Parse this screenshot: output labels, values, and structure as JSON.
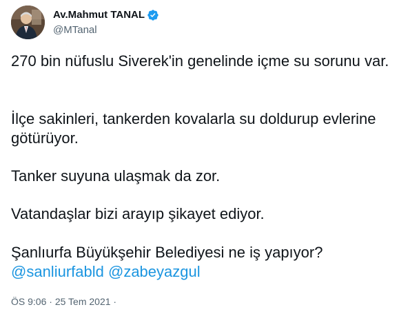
{
  "author": {
    "display_name": "Av.Mahmut TANAL",
    "handle": "@MTanal",
    "verified_icon": "verified-badge-icon",
    "avatar_icon": "profile-photo"
  },
  "tweet": {
    "paragraph_1": "270 bin nüfuslu Siverek'in genelinde içme su sorunu var.",
    "paragraph_2": "İlçe sakinleri, tankerden kovalarla su doldurup evlerine götürüyor.",
    "paragraph_3": "Tanker suyuna ulaşmak da zor.",
    "paragraph_4": "Vatandaşlar bizi arayıp şikayet ediyor.",
    "paragraph_5": "Şanlıurfa Büyükşehir Belediyesi ne iş yapıyor?",
    "mention_1": "@sanliurfabld",
    "mention_2": "@zabeyazgul"
  },
  "meta": {
    "time": "ÖS 9:06",
    "separator": "·",
    "date": "25 Tem 2021",
    "trailing_separator": "·"
  },
  "colors": {
    "text": "#0f1419",
    "secondary": "#536471",
    "link": "#1b95e0",
    "verified": "#1d9bf0"
  }
}
